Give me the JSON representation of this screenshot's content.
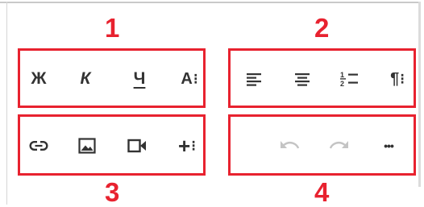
{
  "labels": {
    "group1": "1",
    "group2": "2",
    "group3": "3",
    "group4": "4"
  },
  "toolbar1": {
    "bold": "Ж",
    "italic": "К",
    "underline": "Ч",
    "font": "A",
    "more": "⁝"
  },
  "toolbar2": {
    "paragraph": "¶",
    "more": "⁝"
  },
  "toolbar3": {
    "add": "+",
    "more": "⁝"
  },
  "toolbar4": {
    "overflow": "•••"
  },
  "colors": {
    "highlight": "#e8222f",
    "icon": "#333333",
    "disabled_icon": "#c4c4c4"
  },
  "icons": [
    "bold-icon",
    "italic-icon",
    "underline-icon",
    "font-size-icon",
    "align-left-icon",
    "align-center-icon",
    "numbered-list-icon",
    "paragraph-icon",
    "link-icon",
    "image-icon",
    "video-icon",
    "add-icon",
    "undo-icon",
    "redo-icon",
    "more-icon"
  ]
}
